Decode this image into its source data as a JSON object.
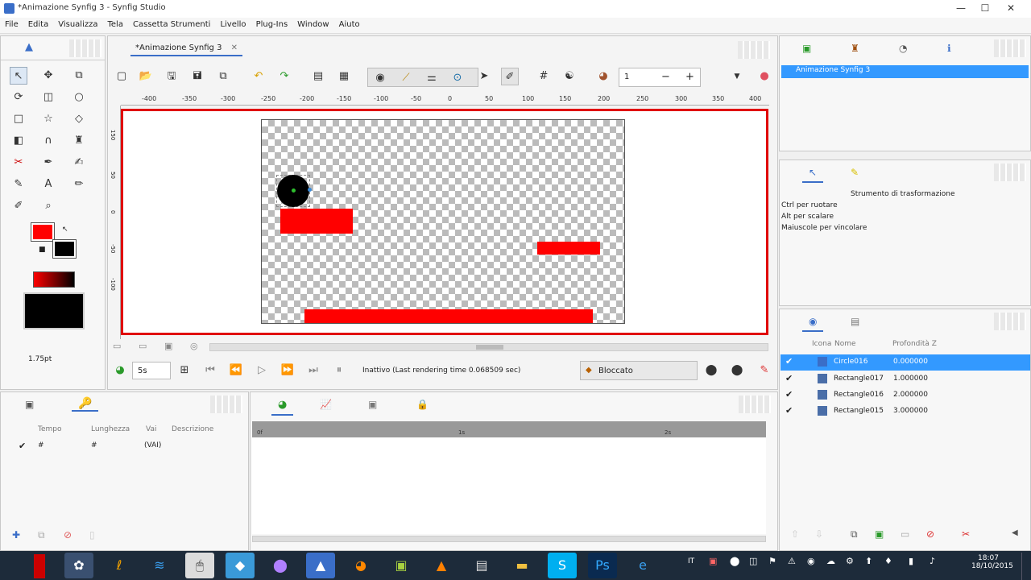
{
  "window": {
    "title": "*Animazione Synfig 3 - Synfig Studio",
    "controls": [
      "—",
      "☐",
      "✕"
    ]
  },
  "menu": [
    "File",
    "Edita",
    "Visualizza",
    "Tela",
    "Cassetta Strumenti",
    "Livello",
    "Plug-Ins",
    "Window",
    "Aiuto"
  ],
  "document_tab": {
    "label": "*Animazione Synfig 3"
  },
  "toolbar": {
    "frame_value": "1",
    "minus": "−",
    "plus": "+"
  },
  "ruler": {
    "h_ticks": [
      "-400",
      "-350",
      "-300",
      "-250",
      "-200",
      "-150",
      "-100",
      "-50",
      "0",
      "50",
      "100",
      "150",
      "200",
      "250",
      "300",
      "350",
      "400"
    ],
    "v_ticks": [
      "150",
      "50",
      "0",
      "-50",
      "-100"
    ]
  },
  "playback": {
    "time_value": "5s",
    "status": "Inattivo (Last rendering time 0.068509 sec)",
    "lock_label": "Bloccato"
  },
  "toolbox": {
    "brush_size": "1.75pt"
  },
  "params_panel": {
    "headers": [
      "Tempo",
      "Lunghezza",
      "Vai",
      "Descrizione"
    ],
    "row": [
      "#",
      "#",
      "(VAI)",
      ""
    ]
  },
  "canvas_browser": {
    "item": "Animazione Synfig 3"
  },
  "tool_options": {
    "title": "Strumento di trasformazione",
    "lines": [
      "Ctrl per ruotare",
      "Alt per scalare",
      "Maiuscole per vincolare"
    ]
  },
  "layers_panel": {
    "headers": [
      "Icona",
      "Nome",
      "Profondità Z"
    ],
    "rows": [
      {
        "name": "Circle016",
        "z": "0.000000",
        "selected": true
      },
      {
        "name": "Rectangle017",
        "z": "1.000000",
        "selected": false
      },
      {
        "name": "Rectangle016",
        "z": "2.000000",
        "selected": false
      },
      {
        "name": "Rectangle015",
        "z": "3.000000",
        "selected": false
      }
    ]
  },
  "timebar": {
    "labels": [
      "0f",
      "1s",
      "2s"
    ]
  },
  "taskbar": {
    "time": "18:07",
    "date": "18/10/2015",
    "lang": "IT"
  },
  "colors": {
    "accent": "#ff0000",
    "selection": "#3399ff",
    "frame": "#e00000"
  }
}
